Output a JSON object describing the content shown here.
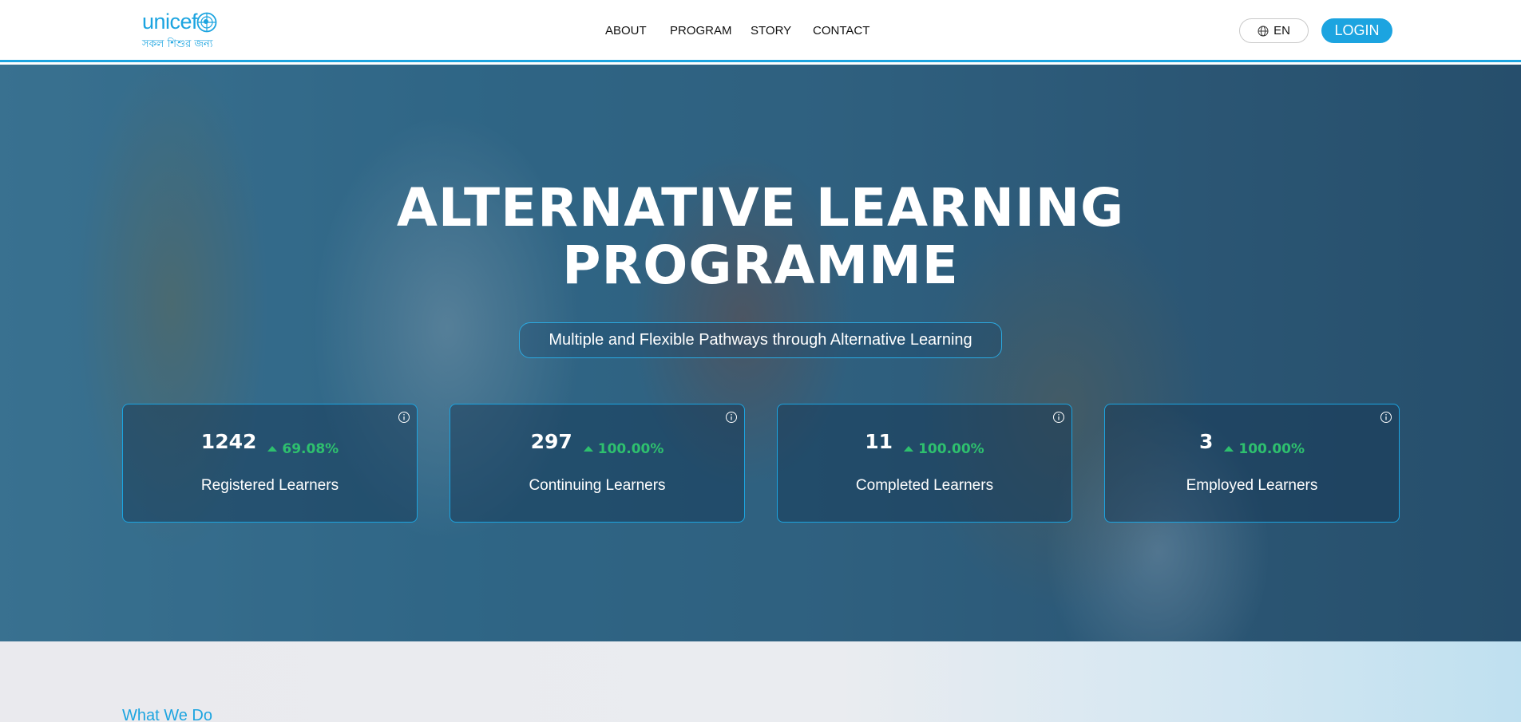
{
  "header": {
    "logo": {
      "wordmark": "unicef",
      "tagline": "সকল শিশুর জন্য"
    },
    "nav": [
      {
        "label": "ABOUT"
      },
      {
        "label": "PROGRAM"
      },
      {
        "label": "STORY"
      },
      {
        "label": "CONTACT"
      }
    ],
    "language": {
      "label": "EN",
      "icon": "globe-icon"
    },
    "login_label": "LOGIN",
    "colors": {
      "accent": "#1ca4e0"
    }
  },
  "hero": {
    "title_line1": "ALTERNATIVE LEARNING",
    "title_line2": "PROGRAMME",
    "subtitle": "Multiple and Flexible Pathways through Alternative Learning",
    "stats": [
      {
        "value": "1242",
        "change": "69.08%",
        "label": "Registered Learners",
        "icon": "info-icon"
      },
      {
        "value": "297",
        "change": "100.00%",
        "label": "Continuing Learners",
        "icon": "info-icon"
      },
      {
        "value": "11",
        "change": "100.00%",
        "label": "Completed Learners",
        "icon": "info-icon"
      },
      {
        "value": "3",
        "change": "100.00%",
        "label": "Employed Learners",
        "icon": "info-icon"
      }
    ],
    "colors": {
      "positive_change": "#2ec06e",
      "card_border": "#1ca4e0"
    }
  },
  "section": {
    "title": "What We Do"
  }
}
